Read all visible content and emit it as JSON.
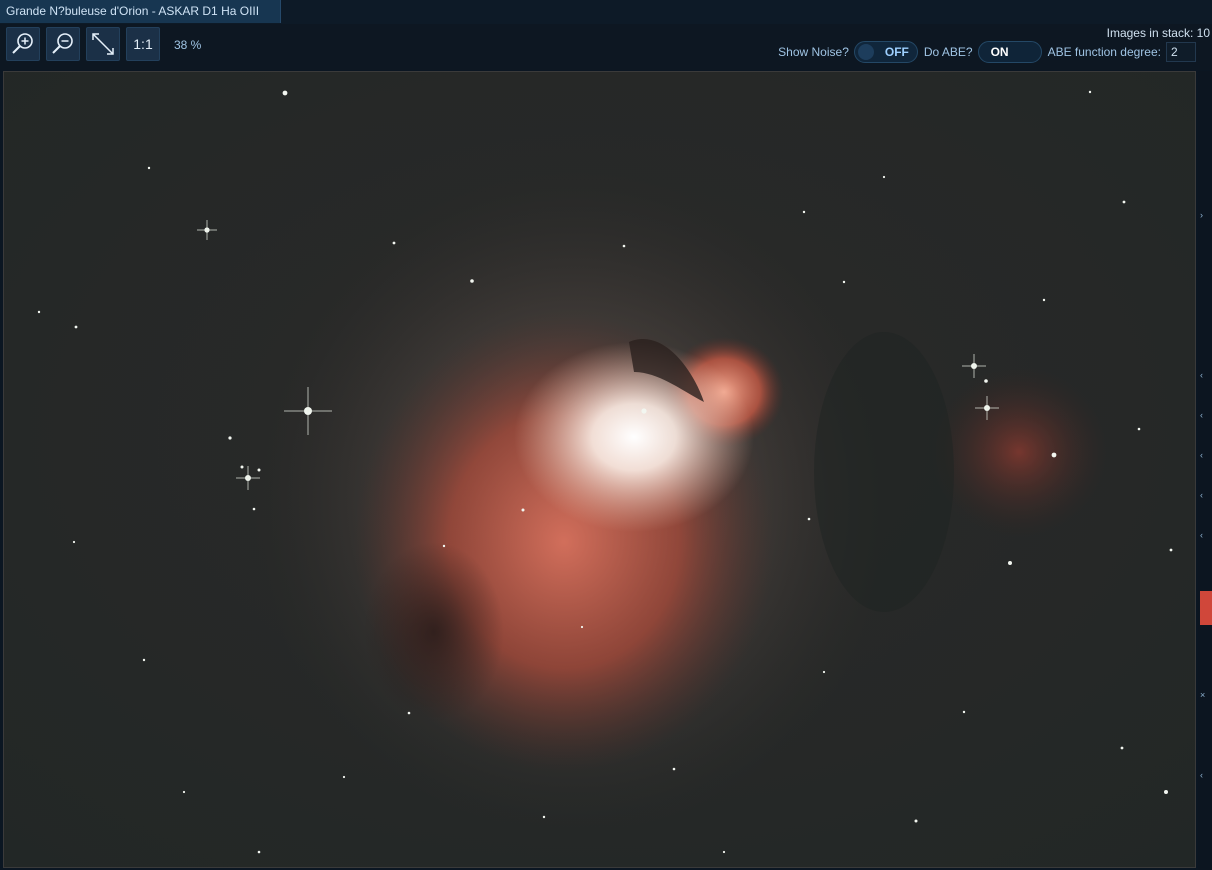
{
  "window": {
    "title": "Grande N?buleuse d'Orion - ASKAR D1 Ha OIII"
  },
  "toolbar": {
    "zoom_in_icon": "zoom-in-icon",
    "zoom_out_icon": "zoom-out-icon",
    "fit_icon": "fit-to-window-icon",
    "one_to_one_label": "1:1",
    "zoom_percent": "38 %"
  },
  "options": {
    "images_in_stack": "Images in stack: 10",
    "show_noise_label": "Show Noise?",
    "show_noise_state": "OFF",
    "do_abe_label": "Do ABE?",
    "do_abe_state": "ON",
    "abe_degree_label": "ABE function degree:",
    "abe_degree_value": "2"
  },
  "colors": {
    "accent": "#173651",
    "toggle_text": "#9ed0ff",
    "nebula_core": "#ffffff",
    "nebula_red": "#c9553e"
  }
}
